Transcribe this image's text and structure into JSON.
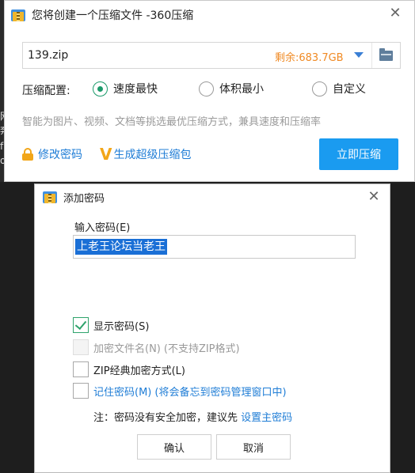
{
  "background": {
    "glyphs": [
      "网",
      "奔",
      "f",
      "o"
    ]
  },
  "main_window": {
    "title": "您将创建一个压缩文件 -360压缩",
    "close": "✕",
    "filename": "139.zip",
    "free_space": "剩余:683.7GB",
    "config_label": "压缩配置:",
    "options": [
      {
        "label": "速度最快",
        "checked": true
      },
      {
        "label": "体积最小",
        "checked": false
      },
      {
        "label": "自定义",
        "checked": false
      }
    ],
    "description": "智能为图片、视频、文档等挑选最优压缩方式，兼具速度和压缩率",
    "change_password": "修改密码",
    "super_package": "生成超级压缩包",
    "compress_button": "立即压缩"
  },
  "password_dialog": {
    "title": "添加密码",
    "close": "✕",
    "input_label": "输入密码(E)",
    "password_value": "上老王论坛当老王",
    "show_password": {
      "label": "显示密码(S)",
      "checked": true
    },
    "encrypt_filename": {
      "label": "加密文件名(N)",
      "note": "(不支持ZIP格式)",
      "checked": false,
      "disabled": true
    },
    "zip_classic": {
      "label": "ZIP经典加密方式(L)",
      "checked": false
    },
    "remember_password": {
      "label": "记住密码(M)",
      "note": "(将会备忘到密码管理窗口中)",
      "checked": false
    },
    "note_text": "注：密码没有安全加密，建议先",
    "note_link": "设置主密码",
    "ok_button": "确认",
    "cancel_button": "取消"
  }
}
